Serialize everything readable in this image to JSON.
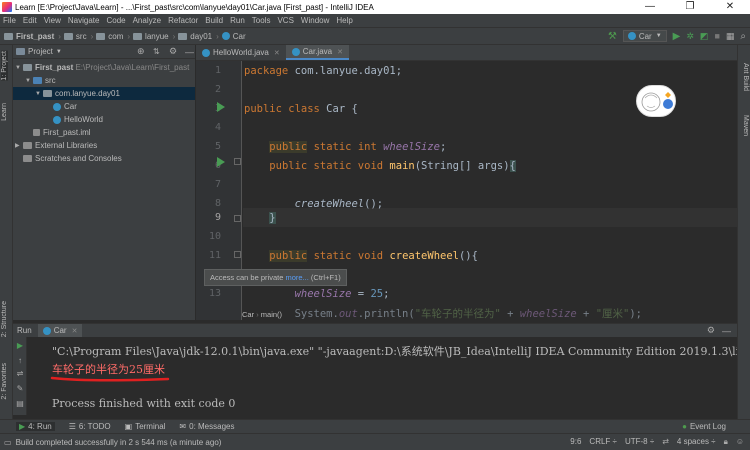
{
  "window": {
    "title": "Learn [E:\\Project\\Java\\Learn] - ...\\First_past\\src\\com\\lanyue\\day01\\Car.java [First_past] - IntelliJ IDEA",
    "controls": [
      "—",
      "❐",
      "✕"
    ]
  },
  "menu": [
    "File",
    "Edit",
    "View",
    "Navigate",
    "Code",
    "Analyze",
    "Refactor",
    "Build",
    "Run",
    "Tools",
    "VCS",
    "Window",
    "Help"
  ],
  "breadcrumbs": [
    "First_past",
    "src",
    "com",
    "lanyue",
    "day01",
    "Car"
  ],
  "run_config": "Car",
  "left_stripe": {
    "project": "1: Project",
    "learn": "Learn",
    "structure": "2: Structure",
    "favorites": "2: Favorites"
  },
  "right_stripe": {
    "ant": "Ant Build",
    "maven": "Maven"
  },
  "project_panel": {
    "header": "Project",
    "tree": [
      {
        "label": "First_past",
        "extra": "E:\\Project\\Java\\Learn\\First_past"
      },
      {
        "label": "src",
        "extra": ""
      },
      {
        "label": "com.lanyue.day01",
        "extra": ""
      },
      {
        "label": "Car",
        "extra": ""
      },
      {
        "label": "HelloWorld",
        "extra": ""
      },
      {
        "label": "First_past.iml",
        "extra": ""
      },
      {
        "label": "External Libraries",
        "extra": ""
      },
      {
        "label": "Scratches and Consoles",
        "extra": ""
      }
    ]
  },
  "editor_tabs": [
    "HelloWorld.java",
    "Car.java"
  ],
  "line_numbers": [
    "1",
    "2",
    "3",
    "4",
    "5",
    "6",
    "7",
    "8",
    "9",
    "10",
    "11",
    "12",
    "13"
  ],
  "tooltip": {
    "text": "Access can be private",
    "link": "more...",
    "shortcut": "(Ctrl+F1)"
  },
  "breadcrumb_code": [
    "Car",
    "main()"
  ],
  "run": {
    "label": "Run",
    "tab": "Car"
  },
  "console": {
    "cmd": "\"C:\\Program Files\\Java\\jdk-12.0.1\\bin\\java.exe\" \"-javaagent:D:\\系统软件\\JB_Idea\\IntelliJ IDEA Community Edition 2019.1.3\\lib\\",
    "output": "车轮子的半径为25厘米",
    "finish": "Process finished with exit code 0"
  },
  "tool_windows": [
    "4: Run",
    "6: TODO",
    "Terminal",
    "0: Messages"
  ],
  "event_log": "Event Log",
  "status": {
    "message": "Build completed successfully in 2 s 544 ms (a minute ago)",
    "position": "9:6",
    "line_sep": "CRLF ÷",
    "encoding": "UTF-8 ÷",
    "indent": "4 spaces ÷"
  },
  "colors": {
    "accent": "#4a88c7",
    "run_green": "#499c54",
    "error_text": "#ff6b68",
    "underline": "#e02020"
  }
}
